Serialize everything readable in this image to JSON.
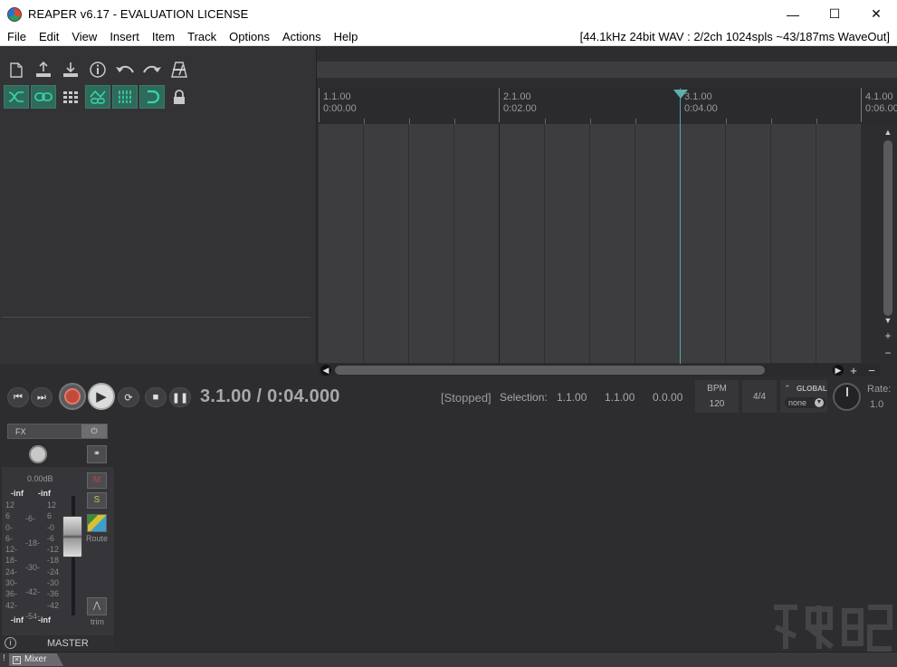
{
  "window": {
    "title": "REAPER v6.17 - EVALUATION LICENSE",
    "minimize": "—",
    "maximize": "☐",
    "close": "✕"
  },
  "menu": {
    "items": [
      "File",
      "Edit",
      "View",
      "Insert",
      "Item",
      "Track",
      "Options",
      "Actions",
      "Help"
    ],
    "audio_status": "[44.1kHz 24bit WAV : 2/2ch 1024spls ~43/187ms WaveOut]"
  },
  "toolbar": {
    "row1_icons": [
      "new-project-icon",
      "open-project-icon",
      "save-project-icon",
      "project-settings-icon",
      "undo-icon",
      "redo-icon",
      "metronome-icon"
    ],
    "row2_icons": [
      "ripple-edit-icon",
      "grouping-icon",
      "snap-grid-icon",
      "auto-crossfade-icon",
      "envelope-points-icon",
      "snap-icon",
      "lock-icon"
    ]
  },
  "ruler": {
    "marks": [
      {
        "measure": "1.1.00",
        "time": "0:00.00"
      },
      {
        "measure": "2.1.00",
        "time": "0:02.00"
      },
      {
        "measure": "3.1.00",
        "time": "0:04.00"
      },
      {
        "measure": "4.1.00",
        "time": "0:06.00"
      }
    ]
  },
  "transport": {
    "position": "3.1.00 / 0:04.000",
    "state": "[Stopped]",
    "selection_label": "Selection:",
    "selection_start": "1.1.00",
    "selection_end": "1.1.00",
    "selection_length": "0.0.00",
    "bpm_label": "BPM",
    "bpm_value": "120",
    "time_signature": "4/4",
    "global_label": "GLOBAL",
    "global_value": "none",
    "rate_label": "Rate:",
    "rate_value": "1.0"
  },
  "master": {
    "fx_label": "FX",
    "fx_power": "⏻",
    "volume_db": "0.00dB",
    "peak_left": "-inf",
    "peak_right": "-inf",
    "peak_left_bottom": "-inf",
    "peak_right_bottom": "-inf",
    "mute": "M",
    "solo": "S",
    "route_label": "Route",
    "trim_label": "trim",
    "name": "MASTER",
    "scale_left": [
      "12",
      "6",
      "0-",
      "6-",
      "12-",
      "18-",
      "24-",
      "30-",
      "36-",
      "42-"
    ],
    "scale_mid": [
      "-6-",
      "-18-",
      "-30-",
      "-42-",
      "-54-"
    ],
    "scale_right": [
      "12",
      "6",
      "-0",
      "-6",
      "-12",
      "-18",
      "-24",
      "-30",
      "-36",
      "-42"
    ]
  },
  "bottom": {
    "mixer_tab": "Mixer",
    "marker": "!"
  },
  "colors": {
    "accent": "#38d6b0",
    "cursor": "#4fa9a9",
    "record": "#c24a3a",
    "mute": "#c04040",
    "solo": "#c8c840"
  }
}
